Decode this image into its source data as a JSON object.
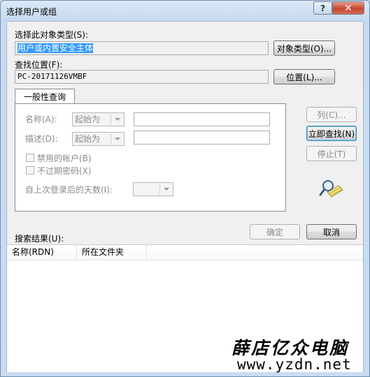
{
  "window": {
    "title": "选择用户或组",
    "help_label": "?",
    "close_label": "✕"
  },
  "object_type": {
    "label": "选择此对象类型(S):",
    "value": "用户或内置安全主体",
    "button": "对象类型(O)..."
  },
  "location": {
    "label": "查找位置(F):",
    "value": "PC-20171126VMBF",
    "button": "位置(L)..."
  },
  "tab": {
    "label": "一般性查询"
  },
  "query": {
    "name_label": "名称(A):",
    "name_mode": "起始为",
    "desc_label": "描述(D):",
    "desc_mode": "起始为",
    "disabled_accounts": "禁用的帐户(B)",
    "nonexpiring_password": "不过期密码(X)",
    "days_since_logon": "自上次登录后的天数(I):"
  },
  "actions": {
    "columns_button": "列(C)...",
    "find_now_button": "立即查找(N)",
    "stop_button": "停止(T)",
    "ok_button": "确定",
    "cancel_button": "取消"
  },
  "results": {
    "label": "搜索结果(U):",
    "columns": [
      "名称(RDN)",
      "所在文件夹"
    ]
  },
  "watermark": {
    "line1": "薛店亿众电脑",
    "line2": "www.yzdn.net"
  }
}
